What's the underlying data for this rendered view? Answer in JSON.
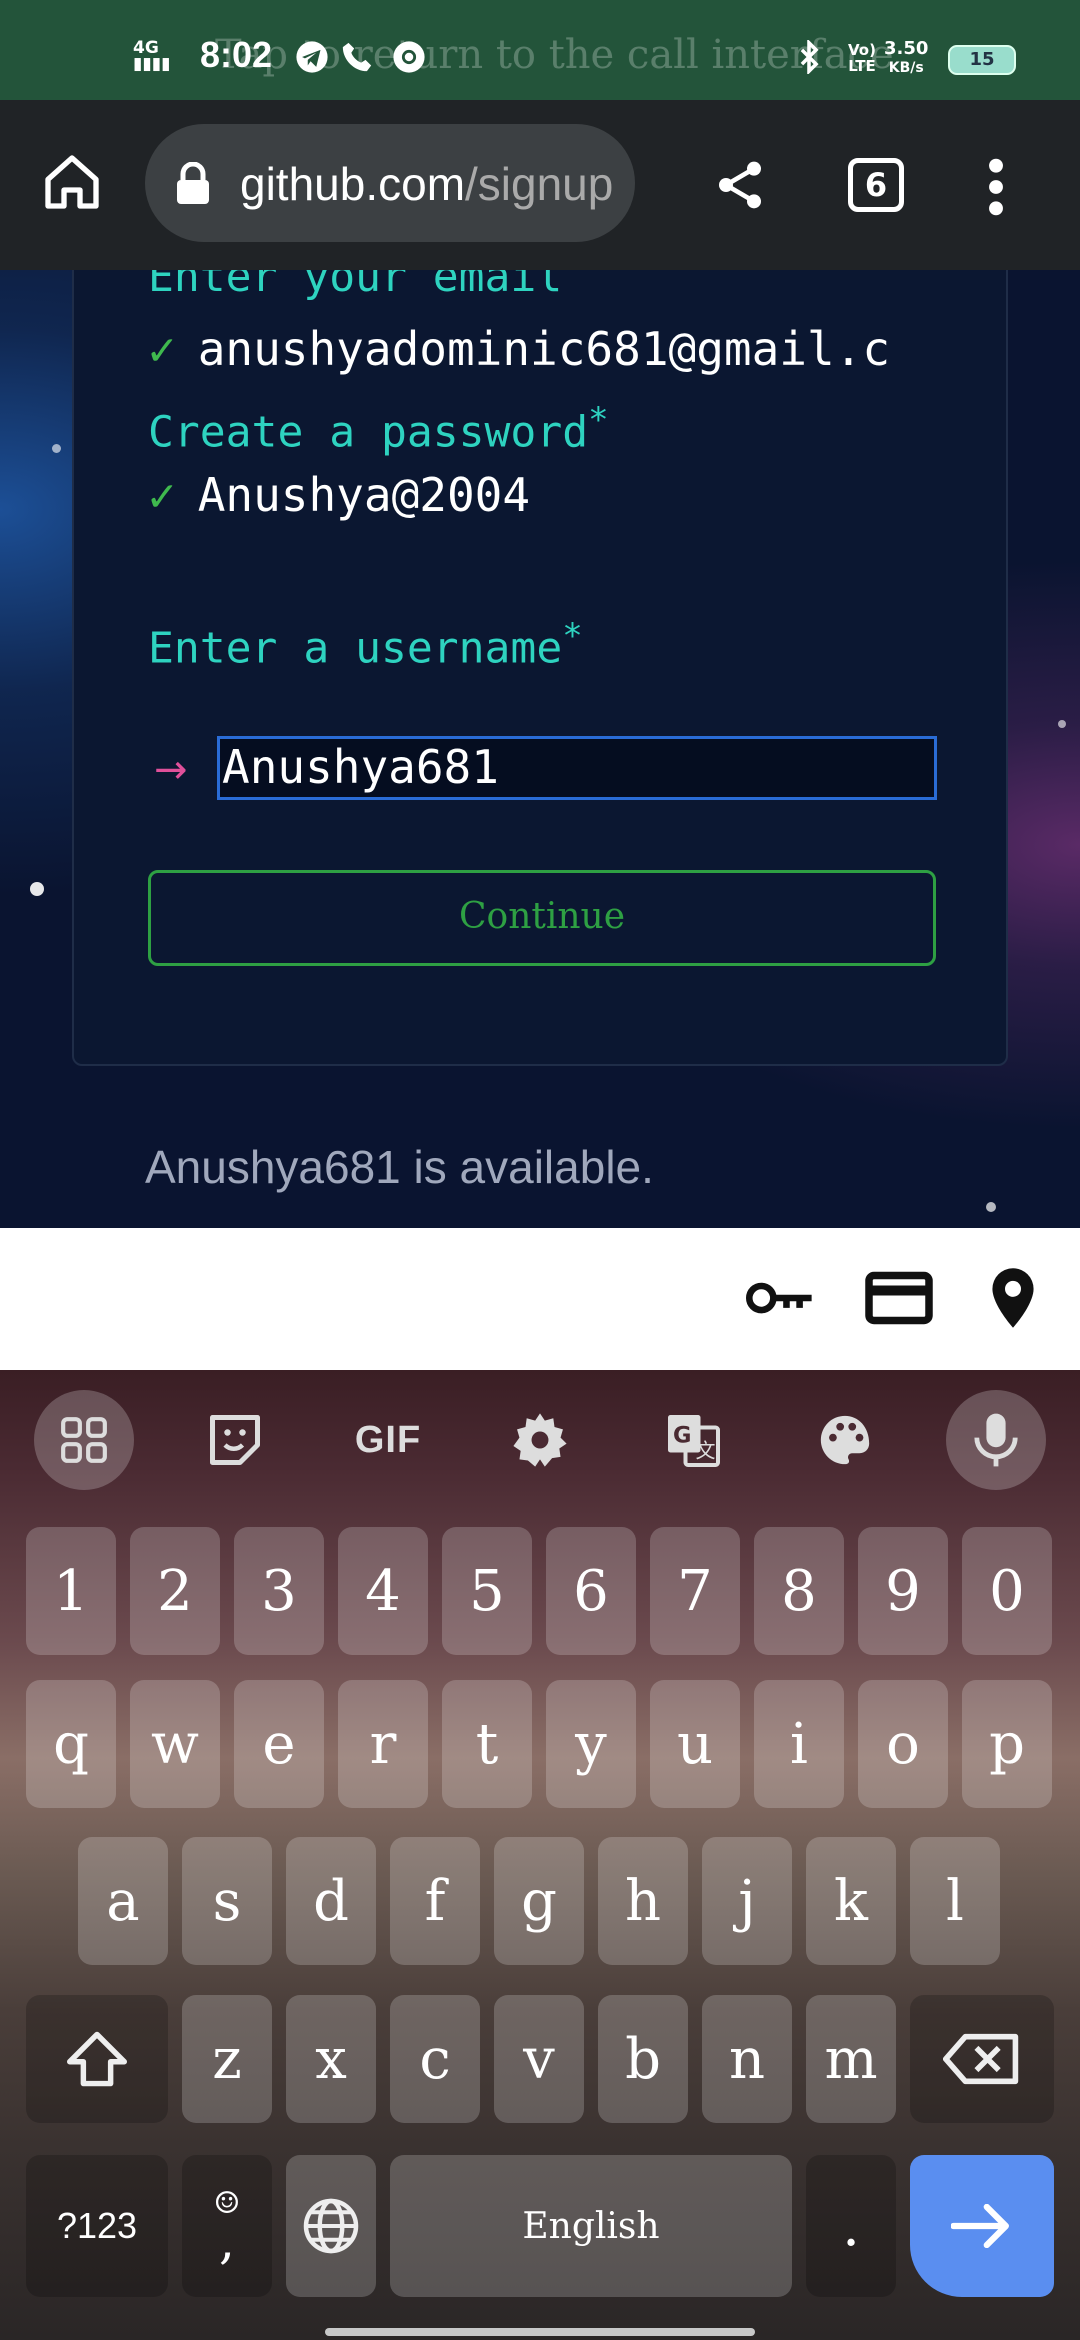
{
  "status_bar": {
    "network": "4G",
    "time": "8:02",
    "overlay_text": "Tap to return to the call interface",
    "volte": "Vo)\nLTE",
    "speed_value": "3.50",
    "speed_unit": "KB/s",
    "battery": "15"
  },
  "browser": {
    "url_host": "github.com",
    "url_path": "/signup",
    "tab_count": "6",
    "icons": [
      "home-icon",
      "lock-icon",
      "share-icon",
      "tabs-icon",
      "overflow-menu-icon"
    ]
  },
  "form": {
    "email_label": "Enter your email",
    "email_value": "anushyadominic681@gmail.c",
    "password_label": "Create a password",
    "password_value": "Anushya@2004",
    "username_label": "Enter a username",
    "username_value": "Anushya681",
    "required_mark": "*",
    "check_mark": "✓",
    "arrow_mark": "→",
    "continue_label": "Continue",
    "availability": "Anushya681 is available.",
    "colors": {
      "label": "#2ed3c0",
      "check": "#3fb94e",
      "button": "#2ea043",
      "focus": "#2a6cd6"
    }
  },
  "autofill": {
    "icons": [
      "key-icon",
      "credit-card-icon",
      "location-pin-icon"
    ]
  },
  "keyboard": {
    "toolbar": {
      "gif_label": "GIF",
      "icons": [
        "apps-grid-icon",
        "sticker-icon",
        "gif-icon",
        "settings-icon",
        "translate-icon",
        "palette-icon",
        "microphone-icon"
      ]
    },
    "row_numbers": [
      "1",
      "2",
      "3",
      "4",
      "5",
      "6",
      "7",
      "8",
      "9",
      "0"
    ],
    "row1": [
      "q",
      "w",
      "e",
      "r",
      "t",
      "y",
      "u",
      "i",
      "o",
      "p"
    ],
    "row2": [
      "a",
      "s",
      "d",
      "f",
      "g",
      "h",
      "j",
      "k",
      "l"
    ],
    "row3": [
      "z",
      "x",
      "c",
      "v",
      "b",
      "n",
      "m"
    ],
    "symbols_label": "?123",
    "comma_label": ",",
    "emoji_label": "☺",
    "space_label": "English",
    "period_label": ".",
    "accent_color": "#5a8ef0"
  }
}
